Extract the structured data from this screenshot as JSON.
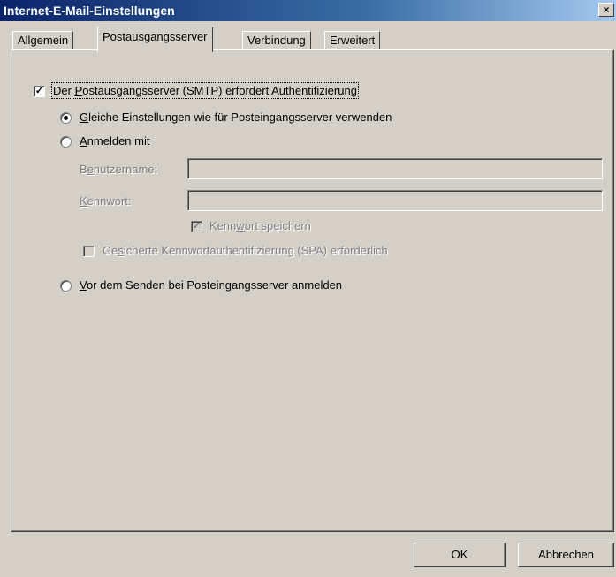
{
  "window": {
    "title": "Internet-E-Mail-Einstellungen",
    "close_glyph": "×"
  },
  "tabs": [
    {
      "label": "Allgemein"
    },
    {
      "label": "Postausgangsserver"
    },
    {
      "label": "Verbindung"
    },
    {
      "label": "Erweitert"
    }
  ],
  "active_tab": "Postausgangsserver",
  "smtp_auth": {
    "label_pre": "Der ",
    "label_key": "P",
    "label_post": "ostausgangsserver (SMTP) erfordert Authentifizierung",
    "checked": true
  },
  "options": {
    "same_settings": {
      "key": "G",
      "rest": "leiche Einstellungen wie für Posteingangsserver verwenden",
      "selected": true
    },
    "login_with": {
      "key": "A",
      "rest": "nmelden mit",
      "selected": false
    },
    "before_send": {
      "key": "V",
      "rest": "or dem Senden bei Posteingangsserver anmelden",
      "selected": false
    }
  },
  "fields": {
    "username": {
      "pre": "B",
      "key": "e",
      "post": "nutzername:",
      "value": ""
    },
    "password": {
      "pre": "",
      "key": "K",
      "post": "ennwort:",
      "value": ""
    }
  },
  "save_password": {
    "pre": "Kenn",
    "key": "w",
    "post": "ort speichern",
    "checked": true,
    "enabled": false
  },
  "spa": {
    "pre": "Ge",
    "key": "s",
    "post": "icherte Kennwortauthentifizierung (SPA) erforderlich",
    "checked": false,
    "enabled": false
  },
  "buttons": {
    "ok": "OK",
    "cancel": "Abbrechen"
  }
}
